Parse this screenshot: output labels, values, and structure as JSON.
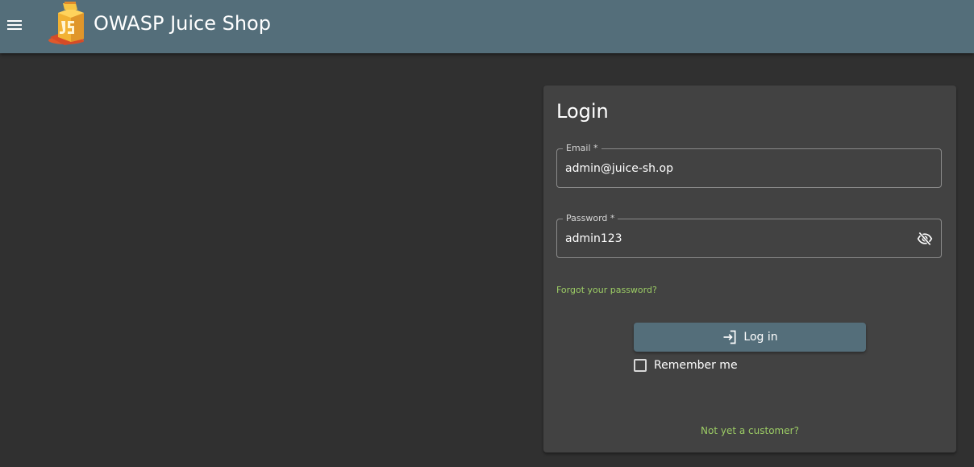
{
  "header": {
    "menu_icon": "menu-icon",
    "logo_icon": "juice-shop-logo",
    "title": "OWASP Juice Shop",
    "background": "#546e7a"
  },
  "login": {
    "title": "Login",
    "email": {
      "label": "Email *",
      "value": "admin@juice-sh.op"
    },
    "password": {
      "label": "Password *",
      "value": "admin123",
      "toggle_icon": "visibility-off-icon"
    },
    "forgot_password": "Forgot your password?",
    "login_button": {
      "label": "Log in",
      "icon": "login-icon"
    },
    "remember_me": "Remember me",
    "register_link": "Not yet a customer?"
  },
  "colors": {
    "background": "#303030",
    "card": "#424242",
    "accent_link": "#9ccc65",
    "primary": "#546e7a"
  }
}
